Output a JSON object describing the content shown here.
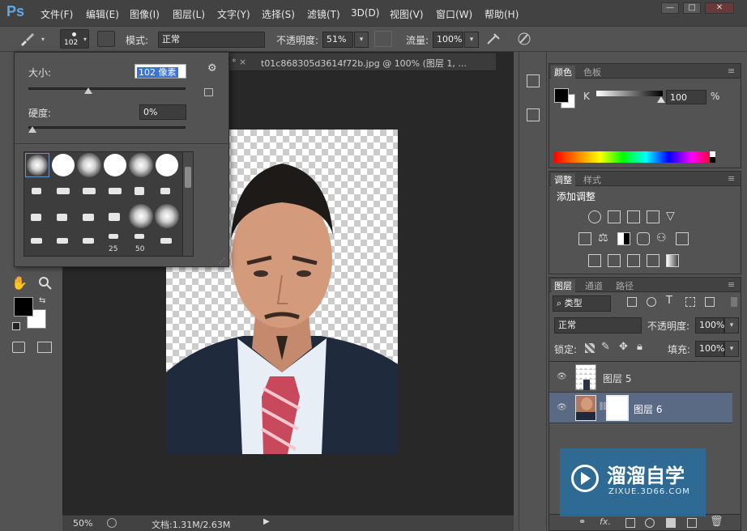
{
  "app": {
    "logo": "Ps"
  },
  "menu": [
    "文件(F)",
    "编辑(E)",
    "图像(I)",
    "图层(L)",
    "文字(Y)",
    "选择(S)",
    "滤镜(T)",
    "3D(D)",
    "视图(V)",
    "窗口(W)",
    "帮助(H)"
  ],
  "window_buttons": [
    "—",
    "□",
    "✕"
  ],
  "options": {
    "brush_size": "102",
    "mode_label": "模式:",
    "mode_value": "正常",
    "opacity_label": "不透明度:",
    "opacity_value": "51%",
    "flow_label": "流量:",
    "flow_value": "100%"
  },
  "brush_popup": {
    "size_label": "大小:",
    "size_value": "102 像素",
    "hardness_label": "硬度:",
    "hardness_value": "0%",
    "size_fraction": 0.38,
    "hardness_fraction": 0.0,
    "brush_numbers": [
      "25",
      "50"
    ]
  },
  "document": {
    "tab_label": "t01c868305d3614f72b.jpg @ 100% (图层 1, ...",
    "tab_prefix": "* ×",
    "zoom": "50%",
    "doc_info": "文档:1.31M/2.63M"
  },
  "color_panel": {
    "tabs": [
      "颜色",
      "色板"
    ],
    "channel": "K",
    "value": "100",
    "unit": "%",
    "colors": {
      "fg": "#000000",
      "bg": "#ffffff"
    }
  },
  "adjust_panel": {
    "tabs": [
      "调整",
      "样式"
    ],
    "title": "添加调整"
  },
  "layers_panel": {
    "tabs": [
      "图层",
      "通道",
      "路径"
    ],
    "filter_label": "类型",
    "blend_mode": "正常",
    "opacity_label": "不透明度:",
    "opacity_value": "100%",
    "lock_label": "锁定:",
    "fill_label": "填充:",
    "fill_value": "100%",
    "layers": [
      {
        "name": "图层 5",
        "selected": false
      },
      {
        "name": "图层 6",
        "selected": true
      }
    ]
  },
  "watermark": {
    "title": "溜溜自学",
    "url": "ZIXUE.3D66.COM"
  }
}
